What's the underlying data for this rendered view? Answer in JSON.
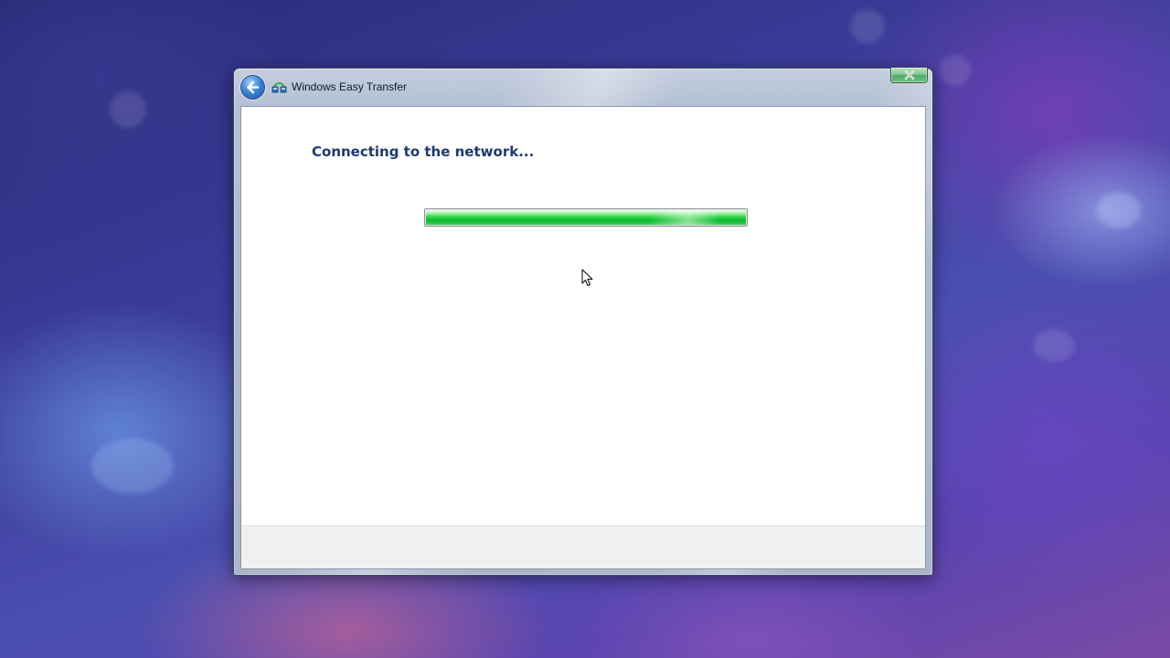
{
  "window": {
    "title": "Windows Easy Transfer",
    "back_button_icon": "back-arrow-icon",
    "app_icon": "easy-transfer-icon",
    "close_icon": "close-icon"
  },
  "main": {
    "heading": "Connecting to the network...",
    "progress": {
      "value_percent": 100,
      "color": "#1cc43a"
    }
  },
  "colors": {
    "heading": "#1d3a73",
    "client_background": "#ffffff",
    "footer_background": "#f0f0f0"
  }
}
